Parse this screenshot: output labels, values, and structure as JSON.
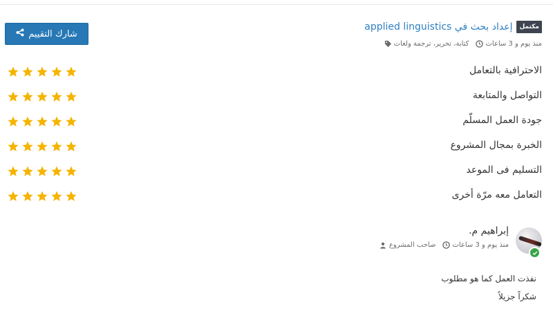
{
  "project": {
    "status_badge": "مكتمل",
    "title": "إعداد بحث في applied linguistics",
    "tags": "كتابة، تحرير، ترجمة ولغات",
    "time_ago": "منذ يوم و 3 ساعات"
  },
  "share_button": {
    "label": "شارك التقييم"
  },
  "ratings": [
    {
      "label": "الاحترافية بالتعامل",
      "stars": 5,
      "max": 5
    },
    {
      "label": "التواصل والمتابعة",
      "stars": 5,
      "max": 5
    },
    {
      "label": "جودة العمل المسلّم",
      "stars": 5,
      "max": 5
    },
    {
      "label": "الخبرة بمجال المشروع",
      "stars": 5,
      "max": 5
    },
    {
      "label": "التسليم فى الموعد",
      "stars": 5,
      "max": 5
    },
    {
      "label": "التعامل معه مرّة أخرى",
      "stars": 5,
      "max": 5
    }
  ],
  "reviewer": {
    "name": "إبراهيم م.",
    "role": "صاحب المشروع",
    "time_ago": "منذ يوم و 3 ساعات",
    "verified": true
  },
  "review": {
    "line1": "نفذت العمل كما هو مطلوب",
    "line2": "شكراً جزيلاً"
  },
  "colors": {
    "accent": "#2778b5",
    "link": "#2f7fc1",
    "star": "#f5b400",
    "badge": "#3f4550",
    "verified": "#3aa34a"
  },
  "icons": {
    "tags": "tags-icon",
    "clock": "clock-icon",
    "share": "share-icon",
    "user": "user-icon",
    "star": "star-icon",
    "check": "check-icon"
  }
}
